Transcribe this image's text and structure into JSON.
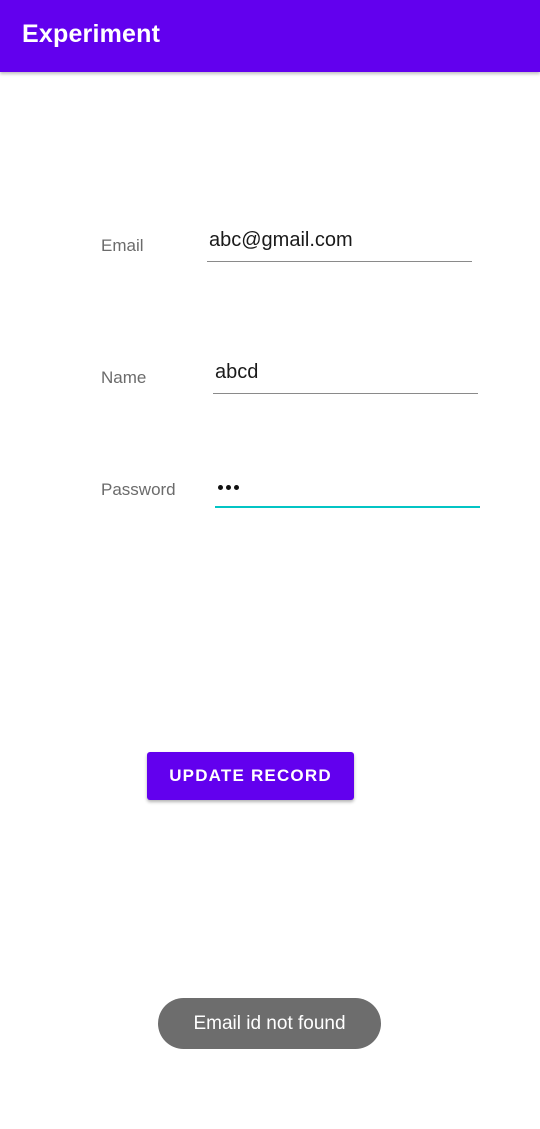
{
  "app_bar": {
    "title": "Experiment",
    "color": "#6200ee"
  },
  "form": {
    "email": {
      "label": "Email",
      "value": "abc@gmail.com"
    },
    "name": {
      "label": "Name",
      "value": "abcd"
    },
    "password": {
      "label": "Password",
      "masked_length": 3,
      "focused": true,
      "focus_color": "#03c4c4"
    }
  },
  "update_button": {
    "label": "UPDATE RECORD"
  },
  "toast": {
    "message": "Email id not found"
  }
}
